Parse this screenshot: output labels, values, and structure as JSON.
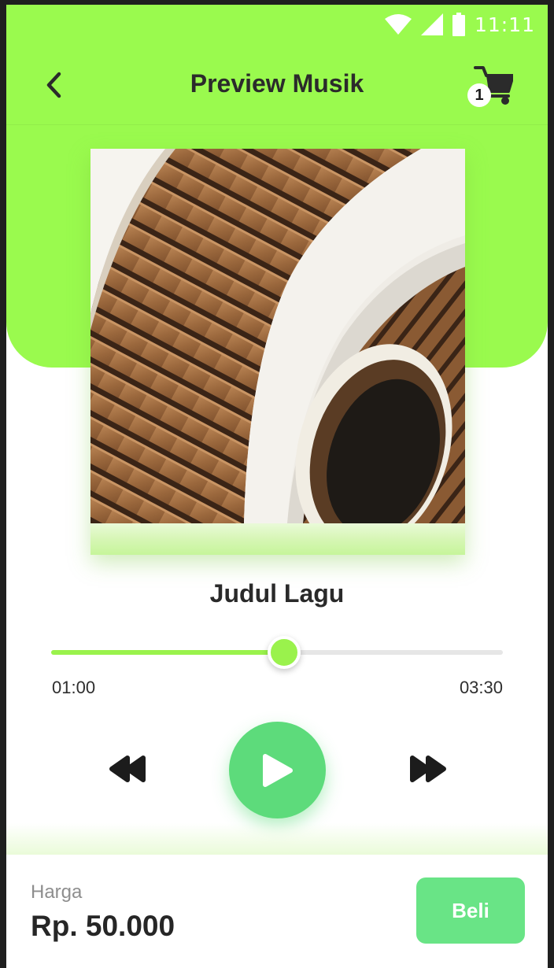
{
  "status_bar": {
    "time": "11:11"
  },
  "app_bar": {
    "title": "Preview Musik",
    "cart_count": "1"
  },
  "song": {
    "title": "Judul Lagu"
  },
  "player": {
    "current_time": "01:00",
    "total_time": "03:30",
    "progress_fraction": 0.516,
    "state": "paused"
  },
  "purchase": {
    "price_label": "Harga",
    "price_value": "Rp. 50.000",
    "buy_label": "Beli"
  },
  "icons": {
    "back": "chevron-left-icon",
    "cart": "shopping-cart-icon",
    "rewind": "rewind-icon",
    "play": "play-icon",
    "forward": "fast-forward-icon",
    "wifi": "wifi-icon",
    "signal": "signal-icon",
    "battery": "battery-icon"
  },
  "colors": {
    "header_green": "#9afa4e",
    "accent_green": "#9af24c",
    "play_button": "#5ddb7b",
    "buy_button": "#69e486",
    "text_dark": "#2b2b2b"
  }
}
